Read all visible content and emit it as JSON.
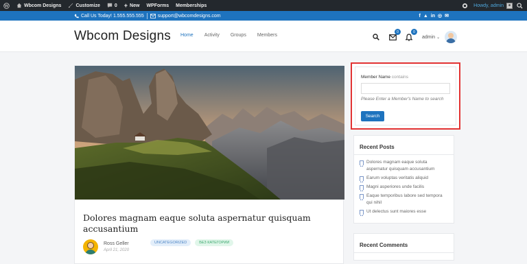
{
  "adminbar": {
    "site_name": "Wbcom Designs",
    "customize": "Customize",
    "comments_count": "0",
    "new": "New",
    "wpforms": "WPForms",
    "memberships": "Memberships",
    "howdy": "Howdy, admin"
  },
  "topbar": {
    "phone": "Call Us Today! 1.555.555.555",
    "email": "support@wbcomdesigns.com",
    "social": [
      "f",
      "▲",
      "in",
      "◎",
      "✉"
    ]
  },
  "header": {
    "logo": "Wbcom Designs",
    "nav": [
      "Home",
      "Activity",
      "Groups",
      "Members"
    ],
    "messages_badge": "0",
    "notifications_badge": "0",
    "user": "admin"
  },
  "post": {
    "title": "Dolores magnam eaque soluta aspernatur quisquam accusantium",
    "author": "Ross Geller",
    "date": "April 21, 2020",
    "tags": [
      "UNCATEGORIZED",
      "БЕЗ КАТЕГОРИИ"
    ]
  },
  "search_widget": {
    "label": "Member Name",
    "label_suffix": "contains",
    "hint": "Please Enter a Member's Name to search",
    "button": "Search"
  },
  "recent_posts": {
    "title": "Recent Posts",
    "items": [
      "Dolores magnam eaque soluta aspernatur quisquam accusantium",
      "Earum voluptas veritatis aliquid",
      "Magni asperiores unde facilis",
      "Eaque temporibus labore sed tempora qui nihil",
      "Ut delectus sunt maiores esse"
    ]
  },
  "recent_comments": {
    "title": "Recent Comments"
  }
}
